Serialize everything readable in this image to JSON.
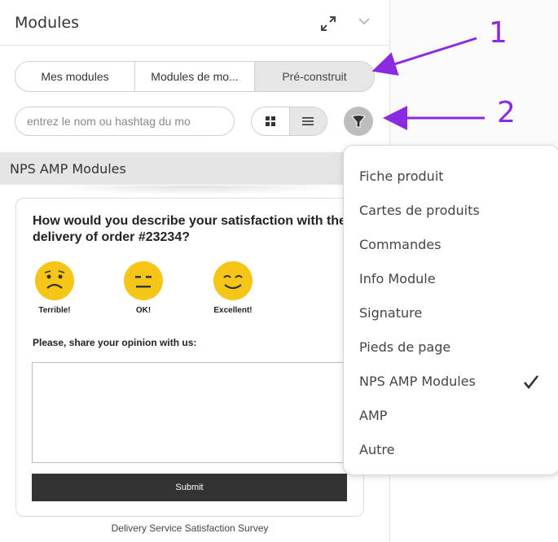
{
  "panel": {
    "title": "Modules",
    "header_icons": [
      "expand-icon",
      "chevron-down-icon"
    ]
  },
  "tabs": [
    {
      "label": "Mes modules",
      "active": false
    },
    {
      "label": "Modules de mo...",
      "active": false
    },
    {
      "label": "Pré-construit",
      "active": true
    }
  ],
  "search": {
    "placeholder": "entrez le nom ou hashtag du mo",
    "value": ""
  },
  "view_toggle": {
    "options": [
      "grid-icon",
      "list-icon"
    ],
    "selected": "list-icon"
  },
  "filter_icon": "filter-icon",
  "section": {
    "label": "NPS AMP Modules"
  },
  "card": {
    "question": "How would you describe your satisfaction with the delivery of order #23234?",
    "faces": [
      {
        "label": "Terrible!",
        "icon": "sad-face-icon"
      },
      {
        "label": "OK!",
        "icon": "neutral-face-icon"
      },
      {
        "label": "Excellent!",
        "icon": "happy-face-icon"
      }
    ],
    "opinion_label": "Please, share your opinion with us:",
    "submit_label": "Submit",
    "caption": "Delivery Service Satisfaction Survey"
  },
  "dropdown": {
    "items": [
      {
        "label": "Fiche produit",
        "checked": false
      },
      {
        "label": "Cartes de produits",
        "checked": false
      },
      {
        "label": "Commandes",
        "checked": false
      },
      {
        "label": "Info Module",
        "checked": false
      },
      {
        "label": "Signature",
        "checked": false
      },
      {
        "label": "Pieds de page",
        "checked": false
      },
      {
        "label": "NPS AMP Modules",
        "checked": true
      },
      {
        "label": "AMP",
        "checked": false
      },
      {
        "label": "Autre",
        "checked": false
      }
    ]
  },
  "annotations": {
    "one": "1",
    "two": "2"
  },
  "colors": {
    "annotation": "#8a2be2",
    "face": "#f5c518",
    "submit_bg": "#333333"
  }
}
